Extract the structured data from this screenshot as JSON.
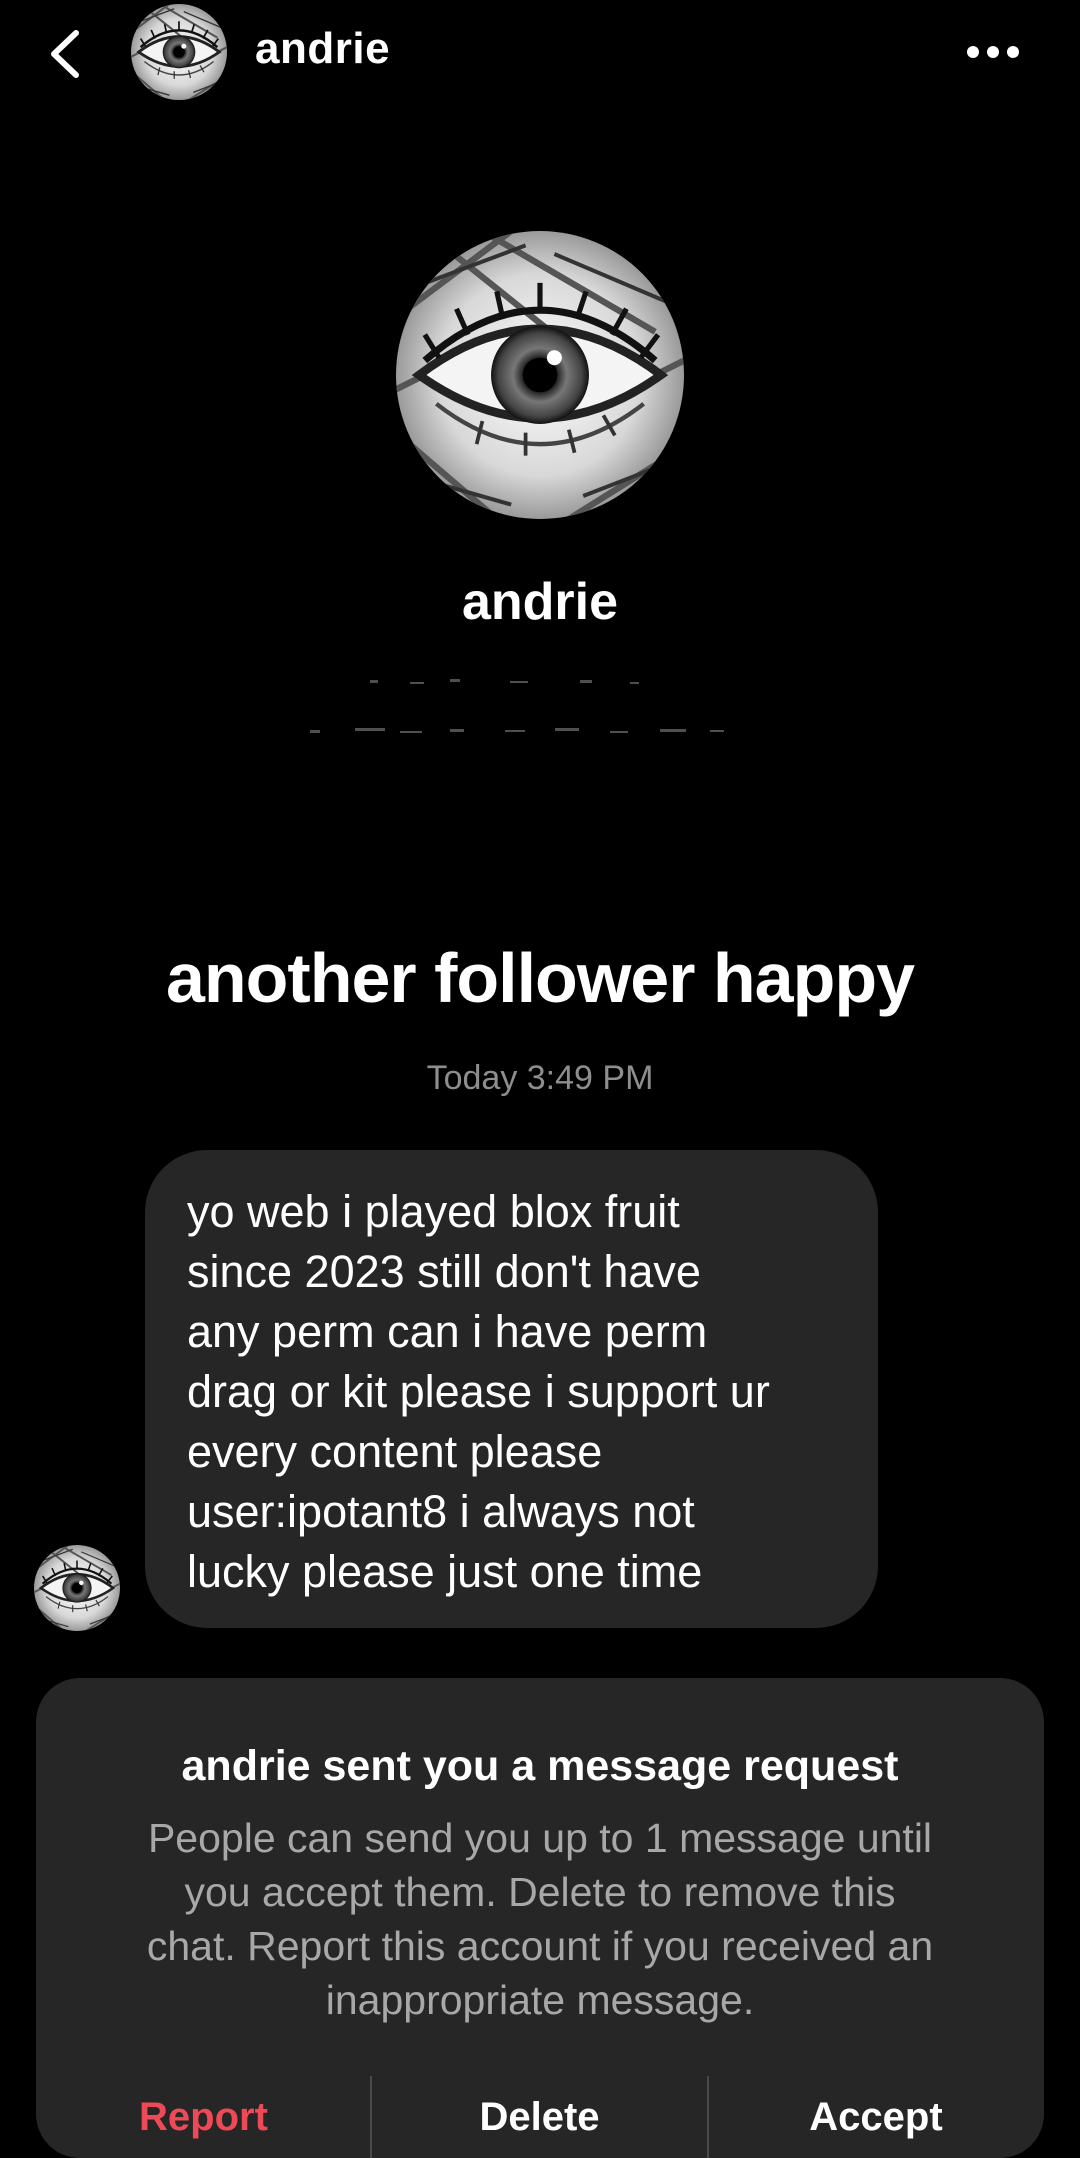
{
  "header": {
    "name": "andrie"
  },
  "profile": {
    "name": "andrie"
  },
  "thread": {
    "title_message": "another follower happy",
    "timestamp": "Today 3:49 PM",
    "message_lines": [
      "yo web i played blox fruit",
      "since 2023 still don't have",
      "any perm can i have perm",
      "drag or kit please i support ur",
      "every content please",
      "user:ipotant8 i always not",
      "lucky please just one time"
    ]
  },
  "request": {
    "title": "andrie sent you a message request",
    "lines": [
      "People can send you up to 1 message until",
      "you accept them. Delete to remove this",
      "chat. Report this account if you received an",
      "inappropriate message."
    ],
    "report_label": "Report",
    "delete_label": "Delete",
    "accept_label": "Accept"
  },
  "colors": {
    "background": "#000000",
    "bubble": "#262626",
    "secondary_text": "#8e8e8e",
    "report": "#ed4956"
  }
}
